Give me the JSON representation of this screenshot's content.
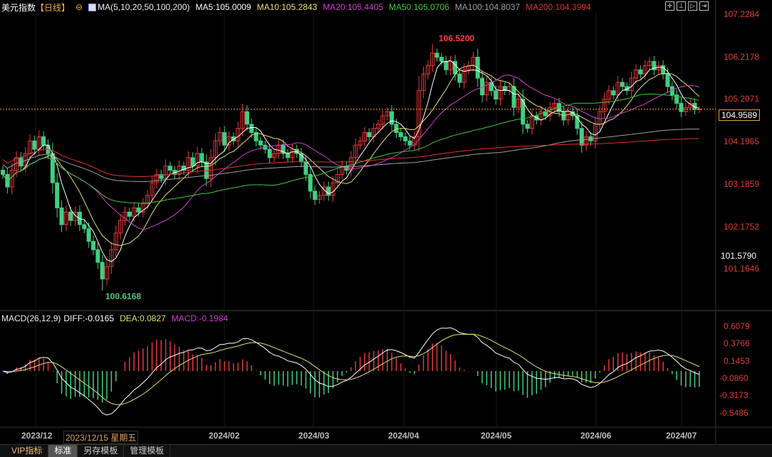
{
  "header": {
    "symbol": "美元指数",
    "period": "【日线】",
    "ma_label": "MA(5,10,20,50,100,200)",
    "ma5": "MA5:105.0009",
    "ma10": "MA10:105.2843",
    "ma20": "MA20:105.4405",
    "ma50": "MA50:105.0706",
    "ma100": "MA100:104.8037",
    "ma200": "MA200:104.3994"
  },
  "macd_header": {
    "label": "MACD(26,12,9)",
    "diff": "DIFF:-0.0165",
    "dea": "DEA:0.0827",
    "macd": "MACD:-0.1984"
  },
  "colors": {
    "up": "#e8373b",
    "down": "#3fcf83",
    "ma5": "#ffffff",
    "ma10": "#e4e070",
    "ma20": "#d040d0",
    "ma50": "#3fc83f",
    "ma100": "#a0a0a0",
    "ma200": "#e03030"
  },
  "price_axis": [
    "107.2284",
    "106.2178",
    "105.2071",
    "104.1965",
    "103.1859",
    "102.1752",
    "101.1646"
  ],
  "macd_axis": [
    "0.6079",
    "0.3766",
    "0.1453",
    "-0.0860",
    "-0.3173",
    "-0.5486"
  ],
  "current_price": "104.9589",
  "crosshair_price": "101.5790",
  "high_label": "106.5200",
  "low_label": "100.6168",
  "x_axis": [
    "2023/12",
    "2024/02",
    "2024/03",
    "2024/04",
    "2024/05",
    "2024/06",
    "2024/07"
  ],
  "cursor_date": "2023/12/15 星期五",
  "tabs": [
    "VIP指标",
    "标准",
    "另存模板",
    "管理模板"
  ],
  "chart_data": {
    "type": "candlestick",
    "title": "美元指数【日线】",
    "ylim": [
      100.6,
      107.23
    ],
    "close": [
      103.4,
      103.1,
      103.5,
      103.8,
      103.6,
      103.9,
      104.2,
      104.0,
      104.3,
      104.1,
      103.9,
      103.2,
      102.6,
      102.2,
      102.5,
      102.3,
      102.5,
      102.2,
      102.1,
      101.8,
      101.6,
      101.3,
      100.9,
      101.2,
      101.6,
      102.0,
      102.3,
      102.5,
      102.4,
      102.6,
      102.5,
      102.7,
      102.9,
      103.2,
      103.4,
      103.3,
      103.6,
      103.5,
      103.4,
      103.6,
      103.5,
      103.8,
      103.6,
      103.9,
      103.7,
      103.3,
      103.8,
      104.2,
      104.4,
      104.1,
      104.3,
      104.2,
      104.5,
      104.9,
      104.6,
      104.4,
      104.2,
      104.1,
      104.0,
      103.8,
      103.9,
      104.1,
      103.9,
      103.8,
      104.0,
      103.9,
      103.7,
      103.4,
      103.0,
      102.8,
      102.9,
      103.1,
      102.9,
      103.2,
      103.4,
      103.6,
      103.5,
      103.8,
      104.1,
      104.2,
      104.4,
      104.3,
      104.5,
      104.6,
      104.8,
      104.9,
      104.6,
      104.4,
      104.3,
      104.2,
      104.1,
      104.3,
      105.4,
      105.8,
      106.0,
      106.3,
      106.2,
      106.1,
      105.9,
      106.1,
      105.8,
      105.6,
      105.9,
      106.0,
      106.2,
      105.7,
      105.3,
      105.6,
      105.4,
      105.2,
      105.5,
      105.4,
      105.5,
      105.0,
      105.2,
      104.6,
      104.5,
      104.8,
      104.7,
      104.9,
      104.8,
      105.0,
      105.1,
      104.9,
      104.7,
      104.9,
      104.8,
      104.5,
      104.1,
      104.3,
      104.2,
      104.6,
      104.9,
      105.2,
      105.4,
      105.3,
      105.6,
      105.5,
      105.4,
      105.7,
      105.9,
      105.8,
      106.0,
      106.1,
      105.9,
      106.0,
      105.8,
      105.5,
      105.3,
      105.1,
      104.9,
      105.0,
      105.1,
      104.95,
      104.96
    ],
    "high": 106.52,
    "low": 100.6168,
    "ma_periods": [
      5,
      10,
      20,
      50,
      100,
      200
    ],
    "macd_params": [
      26,
      12,
      9
    ]
  }
}
